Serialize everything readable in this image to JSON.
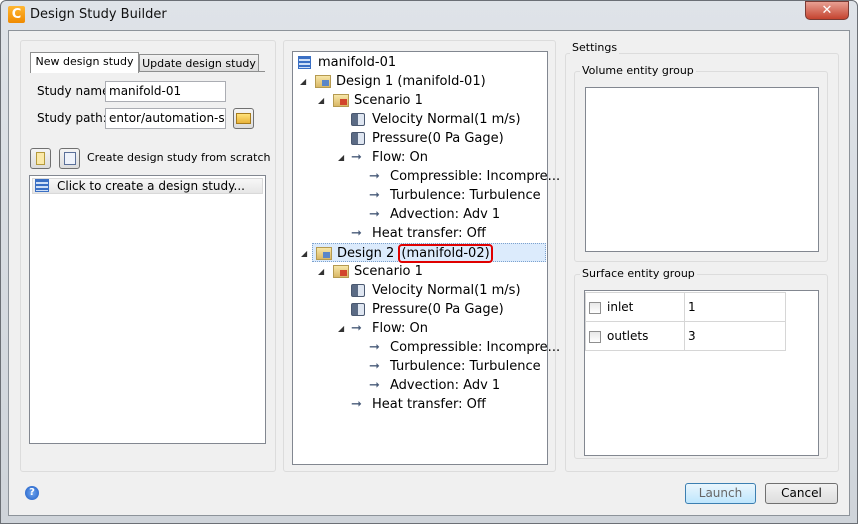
{
  "window": {
    "title": "Design Study Builder",
    "close_label": "✕"
  },
  "left": {
    "tabs": [
      {
        "label": "New design study",
        "active": true
      },
      {
        "label": "Update design study",
        "active": false
      }
    ],
    "study_name_label": "Study name:",
    "study_name_value": "manifold-01",
    "study_path_label": "Study path:",
    "study_path_value": "entor/automation-study",
    "create_label": "Create design study from scratch",
    "list_items": [
      "Click to create a design study..."
    ]
  },
  "tree": [
    {
      "label": "manifold-01",
      "level": 0,
      "icon": "study-icon",
      "expander": false
    },
    {
      "label": "Design 1 (manifold-01)",
      "level": 1,
      "icon": "design-folder-icon",
      "expander": true
    },
    {
      "label": "Scenario 1",
      "level": 2,
      "icon": "scenario-folder-icon",
      "expander": true
    },
    {
      "label": "Velocity Normal(1 m/s)",
      "level": 3,
      "icon": "boundary-condition-icon",
      "expander": false
    },
    {
      "label": "Pressure(0 Pa Gage)",
      "level": 3,
      "icon": "boundary-condition-icon",
      "expander": false
    },
    {
      "label": "Flow: On",
      "level": 3,
      "icon": "arrow-icon",
      "expander": true
    },
    {
      "label": "Compressible: Incompre...",
      "level": 4,
      "icon": "arrow-icon",
      "expander": false
    },
    {
      "label": "Turbulence: Turbulence",
      "level": 4,
      "icon": "arrow-icon",
      "expander": false
    },
    {
      "label": "Advection: Adv 1",
      "level": 4,
      "icon": "arrow-icon",
      "expander": false
    },
    {
      "label": "Heat transfer: Off",
      "level": 3,
      "icon": "arrow-icon",
      "expander": false
    },
    {
      "label": "Design 2 (manifold-02)",
      "level": 1,
      "icon": "design-folder-icon",
      "expander": true,
      "selected": true,
      "highlight": "(manifold-02)"
    },
    {
      "label": "Scenario 1",
      "level": 2,
      "icon": "scenario-folder-icon",
      "expander": true
    },
    {
      "label": "Velocity Normal(1 m/s)",
      "level": 3,
      "icon": "boundary-condition-icon",
      "expander": false
    },
    {
      "label": "Pressure(0 Pa Gage)",
      "level": 3,
      "icon": "boundary-condition-icon",
      "expander": false
    },
    {
      "label": "Flow: On",
      "level": 3,
      "icon": "arrow-icon",
      "expander": true
    },
    {
      "label": "Compressible: Incompre...",
      "level": 4,
      "icon": "arrow-icon",
      "expander": false
    },
    {
      "label": "Turbulence: Turbulence",
      "level": 4,
      "icon": "arrow-icon",
      "expander": false
    },
    {
      "label": "Advection: Adv 1",
      "level": 4,
      "icon": "arrow-icon",
      "expander": false
    },
    {
      "label": "Heat transfer: Off",
      "level": 3,
      "icon": "arrow-icon",
      "expander": false
    }
  ],
  "settings": {
    "title": "Settings",
    "volume_group_label": "Volume entity group",
    "surface_group_label": "Surface entity group",
    "surface_rows": [
      {
        "name": "inlet",
        "value": "1",
        "checked": false
      },
      {
        "name": "outlets",
        "value": "3",
        "checked": false
      }
    ]
  },
  "footer": {
    "help_label": "?",
    "launch_label": "Launch",
    "cancel_label": "Cancel"
  },
  "colors": {
    "highlight_box": "#e00000",
    "selection": "#dcebfc"
  }
}
